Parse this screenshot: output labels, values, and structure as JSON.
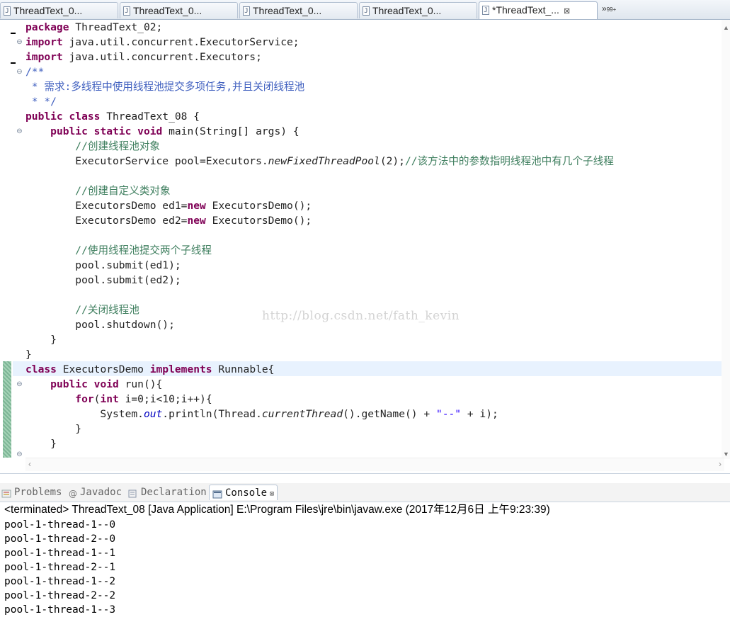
{
  "editor_tabs": [
    {
      "label": "ThreadText_0...",
      "icon": "java-file-icon"
    },
    {
      "label": "ThreadText_0...",
      "icon": "java-file-icon"
    },
    {
      "label": "ThreadText_0...",
      "icon": "java-file-icon"
    },
    {
      "label": "ThreadText_0...",
      "icon": "java-file-icon"
    },
    {
      "label": "*ThreadText_...",
      "icon": "java-file-icon",
      "active": true,
      "close": "⊠"
    }
  ],
  "overflow_label": "»",
  "overflow_count": "99+",
  "code": {
    "l1_kw": "package",
    "l1_rest": " ThreadText_02;",
    "l2_kw": "import",
    "l2_rest": " java.util.concurrent.ExecutorService;",
    "l3_kw": "import",
    "l3_rest": " java.util.concurrent.Executors;",
    "l4": "/**",
    "l5": " * 需求:多线程中使用线程池提交多项任务,并且关闭线程池",
    "l6": " * */",
    "l7_kw": "public class",
    "l7_rest": " ThreadText_08 {",
    "l8_indent": "    ",
    "l8_kw": "public static void",
    "l8_rest": " main(String[] args) {",
    "l9": "        //创建线程池对象",
    "l10_a": "        ExecutorService pool=Executors.",
    "l10_method": "newFixedThreadPool",
    "l10_b": "(2);",
    "l10_comment": "//该方法中的参数指明线程池中有几个子线程",
    "l12": "        //创建自定义类对象",
    "l13_a": "        ExecutorsDemo ed1=",
    "l13_kw": "new",
    "l13_b": " ExecutorsDemo();",
    "l14_a": "        ExecutorsDemo ed2=",
    "l14_kw": "new",
    "l14_b": " ExecutorsDemo();",
    "l16": "        //使用线程池提交两个子线程",
    "l17": "        pool.submit(ed1);",
    "l18": "        pool.submit(ed2);",
    "l20": "        //关闭线程池",
    "l21": "        pool.shutdown();",
    "l22": "    }",
    "l23": "}",
    "l24_kw1": "class",
    "l24_a": " ExecutorsDemo ",
    "l24_kw2": "implements",
    "l24_b": " Runnable{",
    "l25_indent": "    ",
    "l25_kw": "public void",
    "l25_rest": " run(){",
    "l26_indent": "        ",
    "l26_kw1": "for",
    "l26_a": "(",
    "l26_kw2": "int",
    "l26_b": " i=0;i<10;i++){",
    "l27_a": "            System.",
    "l27_field": "out",
    "l27_b": ".println(Thread.",
    "l27_method": "currentThread",
    "l27_c": "().getName() + ",
    "l27_str": "\"--\"",
    "l27_d": " + i);",
    "l28": "        }",
    "l29": "    }"
  },
  "watermark": "http://blog.csdn.net/fath_kevin",
  "view_tabs": {
    "problems": "Problems",
    "javadoc": "Javadoc",
    "declaration": "Declaration",
    "console": "Console",
    "console_close": "⊠"
  },
  "console": {
    "terminated": "<terminated> ThreadText_08 [Java Application] E:\\Program Files\\jre\\bin\\javaw.exe (2017年12月6日 上午9:23:39)",
    "output": [
      "pool-1-thread-1--0",
      "pool-1-thread-2--0",
      "pool-1-thread-1--1",
      "pool-1-thread-2--1",
      "pool-1-thread-1--2",
      "pool-1-thread-2--2",
      "pool-1-thread-1--3"
    ]
  },
  "colors": {
    "keyword": "#7f0055",
    "comment": "#3f7f5f",
    "javadoc": "#3f5fbf",
    "string": "#2a00ff",
    "current_line": "#e8f2fe"
  }
}
